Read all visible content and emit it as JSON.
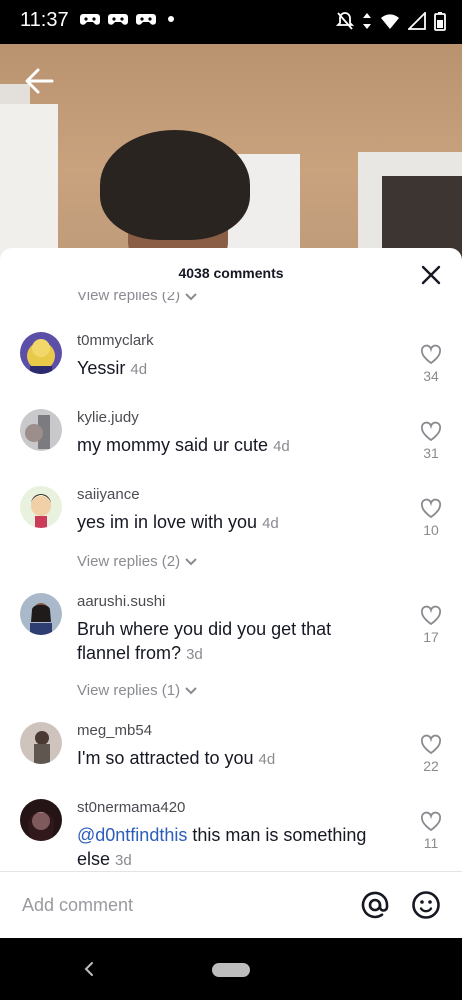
{
  "status_bar": {
    "time": "11:37"
  },
  "sheet": {
    "title": "4038 comments"
  },
  "comments": [
    {
      "username": "t0mmyclark",
      "text": "Yessir",
      "time": "4d",
      "likes": "34"
    },
    {
      "username": "kylie.judy",
      "text": "my mommy said ur cute",
      "time": "4d",
      "likes": "31"
    },
    {
      "username": "saiiyance",
      "text": "yes im in love with you",
      "time": "4d",
      "likes": "10",
      "replies": "View replies (2)"
    },
    {
      "username": "aarushi.sushi",
      "text": "Bruh where you did you get that flannel from?",
      "time": "3d",
      "likes": "17",
      "replies": "View replies (1)"
    },
    {
      "username": "meg_mb54",
      "text": "I'm so attracted to you",
      "time": "4d",
      "likes": "22"
    },
    {
      "username": "st0nermama420",
      "mention": "@d0ntfindthis",
      "text": " this man is something else",
      "time": "3d",
      "likes": "11"
    }
  ],
  "top_replies": "View replies (2)",
  "add_comment": {
    "placeholder": "Add comment"
  },
  "icons": {
    "back": "arrow-left-icon",
    "close": "close-icon",
    "like": "heart-outline-icon",
    "mention": "at-sign-icon",
    "emoji": "smiley-icon",
    "chevron": "chevron-down-icon"
  },
  "colors": {
    "mention": "#2b5db9",
    "muted": "#8a8b91",
    "text": "#161823"
  }
}
